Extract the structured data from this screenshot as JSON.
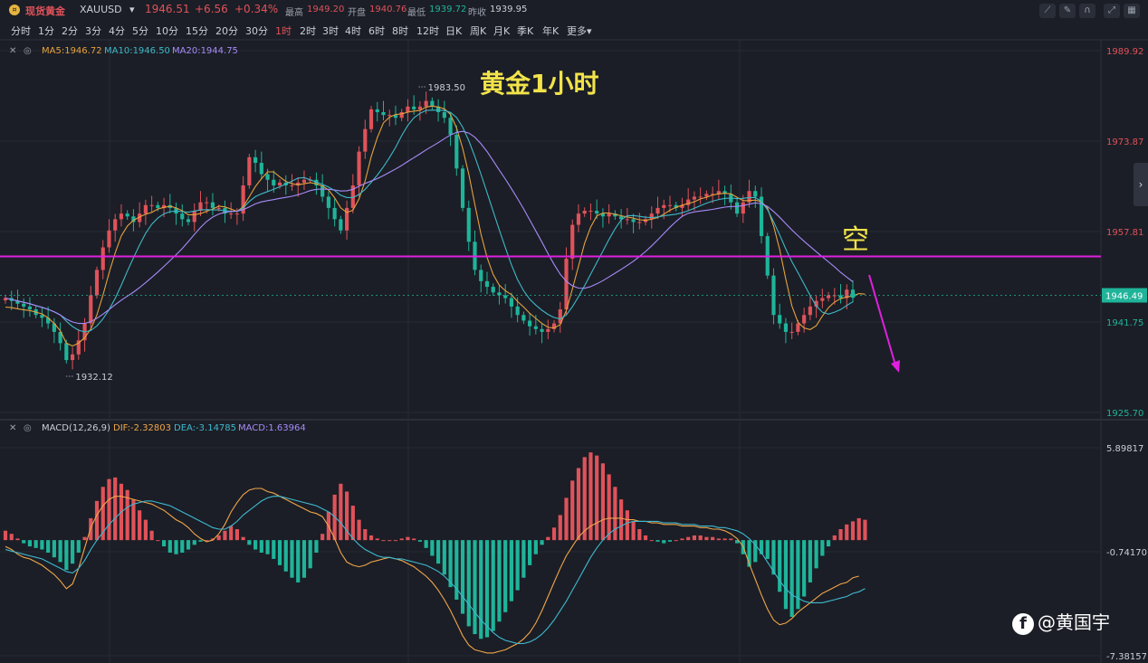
{
  "header": {
    "name": "现货黄金",
    "symbol": "XAUUSD",
    "symbol_caret": "▾",
    "price": "1946.51",
    "change": "+6.56",
    "change_pct": "+0.34%",
    "high_label": "最高",
    "high": "1949.20",
    "open_label": "开盘",
    "open": "1940.76",
    "low_label": "最低",
    "low": "1939.72",
    "prev_label": "昨收",
    "prev": "1939.95"
  },
  "toolbar": {
    "icons": [
      "draw-line-icon",
      "pencil-icon",
      "magnet-icon",
      "fullscreen-icon",
      "grid-icon"
    ]
  },
  "intervals": [
    "分时",
    "1分",
    "2分",
    "3分",
    "4分",
    "5分",
    "10分",
    "15分",
    "20分",
    "30分",
    "1时",
    "2时",
    "3时",
    "4时",
    "6时",
    "8时",
    "12时",
    "日K",
    "周K",
    "月K",
    "季K",
    "年K",
    "更多▾"
  ],
  "active_interval": "1时",
  "colors": {
    "up": "#e0525a",
    "down": "#1fb49a",
    "ma5": "#e6a23c",
    "ma10": "#3fb8c8",
    "ma20": "#a78bfa",
    "annotation": "#e020e0",
    "title": "#f2e34a",
    "dif": "#f0a64a",
    "dea": "#3fb8d0"
  },
  "main_legend": {
    "ma5": "MA5:1946.72",
    "ma10": "MA10:1946.50",
    "ma20": "MA20:1944.75"
  },
  "macd_legend": {
    "name": "MACD(12,26,9)",
    "dif": "DIF:-2.32803",
    "dea": "DEA:-3.14785",
    "macd": "MACD:1.63964"
  },
  "watermark": "@黄国宇",
  "chart_data": [
    {
      "type": "candlestick",
      "title": "黄金1小时",
      "annotation": "空",
      "ylim": [
        1925.7,
        1989.92
      ],
      "y_ticks": [
        1989.92,
        1973.87,
        1957.81,
        1941.75,
        1925.7
      ],
      "current_price": 1946.49,
      "high_label": "1983.50",
      "low_label": "1932.12",
      "resistance_level": 1953.4,
      "close": [
        1946,
        1945.5,
        1945,
        1944.5,
        1944,
        1943,
        1942.5,
        1941.5,
        1940,
        1938,
        1935,
        1936,
        1938.5,
        1941.5,
        1946.5,
        1951,
        1955,
        1958,
        1960,
        1961,
        1960.5,
        1959.5,
        1961,
        1962.5,
        1962.5,
        1962,
        1962.5,
        1962,
        1961,
        1960,
        1959.5,
        1961.5,
        1963,
        1963,
        1962,
        1962,
        1961,
        1961,
        1961,
        1966,
        1971,
        1970,
        1968,
        1967,
        1966,
        1966.5,
        1966,
        1966,
        1966.5,
        1967,
        1967,
        1966,
        1964,
        1962,
        1960,
        1958,
        1962,
        1966,
        1972,
        1976,
        1979.5,
        1979,
        1978.5,
        1978.5,
        1978,
        1979,
        1980,
        1979.5,
        1980,
        1981,
        1980,
        1979,
        1978,
        1975,
        1969,
        1962,
        1956,
        1951,
        1949,
        1948,
        1947,
        1946.5,
        1946,
        1944.5,
        1943,
        1942,
        1941,
        1940.5,
        1940,
        1940.5,
        1941.5,
        1944,
        1953,
        1959,
        1961,
        1961.5,
        1961.5,
        1961,
        1960.5,
        1961,
        1960.5,
        1960,
        1960,
        1959.5,
        1959.5,
        1960,
        1961,
        1962,
        1962.5,
        1962.5,
        1962,
        1962.5,
        1963.5,
        1964,
        1964,
        1964.5,
        1964.5,
        1965,
        1964.5,
        1963,
        1961,
        1963,
        1965,
        1964,
        1957,
        1950,
        1943,
        1941.5,
        1940,
        1940,
        1941.5,
        1943,
        1944.5,
        1945.5,
        1946,
        1946.5,
        1946.5,
        1946,
        1947.5,
        1946.5
      ],
      "ma5": [
        1944.4,
        1944.3,
        1944.1,
        1943.9,
        1943.8,
        1943.5,
        1943.2,
        1942.5,
        1941.5,
        1940.2,
        1938,
        1937.5,
        1938,
        1939,
        1940.5,
        1943,
        1946.5,
        1950.5,
        1954,
        1957,
        1958.8,
        1959.8,
        1960.4,
        1960.9,
        1961.2,
        1961.8,
        1962.1,
        1962.3,
        1962,
        1961.5,
        1960.8,
        1960.8,
        1961,
        1961.4,
        1961.8,
        1962.3,
        1962.2,
        1961.8,
        1961.4,
        1962.2,
        1964,
        1965.8,
        1967.2,
        1968.4,
        1968.4,
        1967.5,
        1966.7,
        1966.3,
        1966.1,
        1966.3,
        1966.5,
        1966.3,
        1965.9,
        1965.2,
        1963.8,
        1962,
        1961.2,
        1961.6,
        1963.6,
        1966.8,
        1971.1,
        1974.5,
        1977.1,
        1978.1,
        1978.6,
        1978.7,
        1979,
        1979.2,
        1979.3,
        1979.9,
        1980.1,
        1979.9,
        1979.6,
        1978.6,
        1976.2,
        1972.6,
        1968,
        1962.6,
        1957.4,
        1953.2,
        1950.2,
        1948.3,
        1947.3,
        1946.6,
        1945.4,
        1944.4,
        1943.3,
        1942.4,
        1941.5,
        1940.8,
        1940.7,
        1941.3,
        1943.8,
        1947.6,
        1951.7,
        1955.7,
        1958.6,
        1960.6,
        1961.1,
        1961.1,
        1960.9,
        1960.6,
        1960.4,
        1960.2,
        1959.9,
        1959.8,
        1960,
        1960.3,
        1960.9,
        1961.6,
        1962.1,
        1962.5,
        1962.8,
        1963.1,
        1963.6,
        1963.9,
        1964.3,
        1964.5,
        1964.6,
        1964.5,
        1963.9,
        1963.3,
        1963.3,
        1963.4,
        1963.1,
        1962,
        1958.8,
        1954.6,
        1949.4,
        1944.6,
        1941.7,
        1940.7,
        1940.4,
        1941.1,
        1942.8,
        1944.3,
        1945.3,
        1945.9,
        1946.2,
        1946.4,
        1946.8,
        1946.7
      ]
    },
    {
      "type": "macd",
      "ylim": [
        -7.38157,
        5.89817
      ],
      "y_ticks": [
        5.89817,
        -0.7417,
        -7.38157
      ],
      "histogram": [
        0.6,
        0.4,
        0.1,
        -0.2,
        -0.4,
        -0.5,
        -0.6,
        -0.8,
        -1.1,
        -1.4,
        -1.9,
        -1.5,
        -0.8,
        0.2,
        1.4,
        2.5,
        3.4,
        3.9,
        4,
        3.6,
        3.2,
        2.6,
        1.9,
        1.3,
        0.6,
        0,
        -0.4,
        -0.8,
        -0.9,
        -0.8,
        -0.6,
        -0.3,
        -0.1,
        0,
        0.1,
        0.3,
        0.6,
        0.9,
        0.7,
        0.2,
        -0.3,
        -0.6,
        -0.8,
        -0.9,
        -1.2,
        -1.6,
        -2,
        -2.4,
        -2.7,
        -2.4,
        -1.8,
        -0.8,
        0.4,
        1.8,
        2.9,
        3.6,
        3.1,
        2.2,
        1.3,
        0.7,
        0.3,
        0.1,
        0,
        0,
        0,
        0.1,
        0.2,
        0.1,
        -0.1,
        -0.5,
        -1,
        -1.5,
        -2.2,
        -3,
        -3.8,
        -4.7,
        -5.5,
        -6,
        -6.3,
        -6.2,
        -5.8,
        -5.2,
        -4.6,
        -3.9,
        -3.2,
        -2.4,
        -1.6,
        -0.9,
        -0.3,
        0.2,
        0.8,
        1.6,
        2.7,
        3.8,
        4.6,
        5.3,
        5.6,
        5.4,
        4.9,
        4.2,
        3.4,
        2.6,
        1.9,
        1.2,
        0.7,
        0.3,
        0,
        -0.1,
        -0.2,
        -0.1,
        0,
        0.1,
        0.2,
        0.3,
        0.3,
        0.2,
        0.2,
        0.1,
        0.1,
        0.1,
        -0.2,
        -0.9,
        -1.7,
        -1.4,
        -0.9,
        -1.2,
        -2.2,
        -3.3,
        -4.4,
        -4.9,
        -4.4,
        -3.6,
        -2.7,
        -1.8,
        -1,
        -0.4,
        0.3,
        0.7,
        1,
        1.2,
        1.4,
        1.3
      ],
      "dif": [
        -0.4,
        -0.6,
        -0.9,
        -1.1,
        -1.2,
        -1.4,
        -1.6,
        -1.9,
        -2.2,
        -2.6,
        -3.1,
        -2.8,
        -1.8,
        -0.5,
        0.8,
        1.6,
        2.2,
        2.6,
        2.8,
        2.8,
        2.7,
        2.6,
        2.5,
        2.4,
        2.3,
        2.1,
        1.9,
        1.6,
        1.3,
        1.1,
        0.8,
        0.4,
        0.1,
        -0.1,
        0,
        0.4,
        1,
        1.8,
        2.4,
        2.9,
        3.2,
        3.3,
        3.3,
        3.1,
        3,
        2.8,
        2.6,
        2.4,
        2.2,
        2,
        1.8,
        1.7,
        1.5,
        0.9,
        0.1,
        -0.8,
        -1.4,
        -1.6,
        -1.7,
        -1.6,
        -1.4,
        -1.3,
        -1.2,
        -1.1,
        -1.2,
        -1.3,
        -1.5,
        -1.7,
        -2,
        -2.3,
        -2.7,
        -3.2,
        -3.8,
        -4.5,
        -5.3,
        -6.1,
        -6.7,
        -7,
        -7.1,
        -7.2,
        -7.2,
        -7.1,
        -7,
        -6.8,
        -6.6,
        -6.3,
        -5.9,
        -5.3,
        -4.5,
        -3.6,
        -2.7,
        -1.8,
        -1,
        -0.4,
        0.2,
        0.6,
        0.9,
        1.1,
        1.3,
        1.4,
        1.4,
        1.4,
        1.3,
        1.3,
        1.2,
        1.2,
        1.1,
        1.1,
        1,
        1,
        1,
        0.9,
        0.9,
        0.9,
        0.8,
        0.8,
        0.7,
        0.7,
        0.6,
        0.4,
        0.1,
        -0.4,
        -1.5,
        -2.5,
        -3.5,
        -4.4,
        -5.1,
        -5.4,
        -5.3,
        -5,
        -4.6,
        -4.3,
        -4,
        -3.7,
        -3.4,
        -3.2,
        -3,
        -2.8,
        -2.7,
        -2.4,
        -2.3
      ],
      "dea": [
        -0.6,
        -0.7,
        -0.8,
        -0.9,
        -1,
        -1.1,
        -1.2,
        -1.4,
        -1.6,
        -1.8,
        -2,
        -2.1,
        -1.8,
        -1.3,
        -0.6,
        0,
        0.5,
        1,
        1.4,
        1.8,
        2.1,
        2.3,
        2.4,
        2.5,
        2.5,
        2.4,
        2.3,
        2.2,
        2,
        1.8,
        1.6,
        1.4,
        1.2,
        1,
        0.8,
        0.7,
        0.7,
        0.9,
        1.2,
        1.6,
        1.9,
        2.2,
        2.5,
        2.7,
        2.8,
        2.8,
        2.7,
        2.6,
        2.5,
        2.4,
        2.3,
        2.2,
        2,
        1.8,
        1.5,
        1.1,
        0.6,
        0.1,
        -0.3,
        -0.6,
        -0.8,
        -1,
        -1.1,
        -1.1,
        -1.2,
        -1.2,
        -1.3,
        -1.4,
        -1.5,
        -1.6,
        -1.8,
        -2,
        -2.3,
        -2.7,
        -3.1,
        -3.6,
        -4.1,
        -4.6,
        -5.1,
        -5.5,
        -5.9,
        -6.2,
        -6.4,
        -6.5,
        -6.6,
        -6.6,
        -6.5,
        -6.3,
        -6,
        -5.6,
        -5.1,
        -4.5,
        -3.9,
        -3.2,
        -2.5,
        -1.8,
        -1.1,
        -0.5,
        0,
        0.4,
        0.7,
        0.9,
        1.1,
        1.2,
        1.2,
        1.2,
        1.2,
        1.2,
        1.1,
        1.1,
        1.1,
        1,
        1,
        1,
        0.9,
        0.9,
        0.9,
        0.8,
        0.8,
        0.7,
        0.6,
        0.4,
        0.1,
        -0.3,
        -0.8,
        -1.4,
        -2,
        -2.6,
        -3.1,
        -3.5,
        -3.7,
        -3.9,
        -4,
        -4,
        -4,
        -3.9,
        -3.8,
        -3.7,
        -3.6,
        -3.4,
        -3.3,
        -3.1
      ]
    }
  ]
}
